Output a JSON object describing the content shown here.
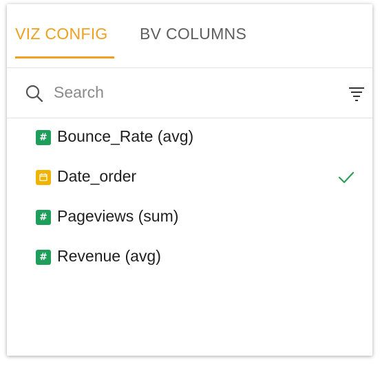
{
  "tabs": [
    {
      "label": "VIZ CONFIG",
      "active": true
    },
    {
      "label": "BV COLUMNS",
      "active": false
    }
  ],
  "search": {
    "placeholder": "Search",
    "value": ""
  },
  "columns": [
    {
      "label": "Bounce_Rate (avg)",
      "type_icon": "number-hash-icon",
      "checked": false
    },
    {
      "label": "Date_order",
      "type_icon": "calendar-icon",
      "checked": true
    },
    {
      "label": "Pageviews (sum)",
      "type_icon": "number-hash-icon",
      "checked": false
    },
    {
      "label": "Revenue (avg)",
      "type_icon": "number-hash-icon",
      "checked": false
    }
  ],
  "colors": {
    "accent": "#f0a020",
    "number_badge": "#1e9e5a",
    "date_badge": "#f0b400",
    "check": "#2e9e5a"
  }
}
